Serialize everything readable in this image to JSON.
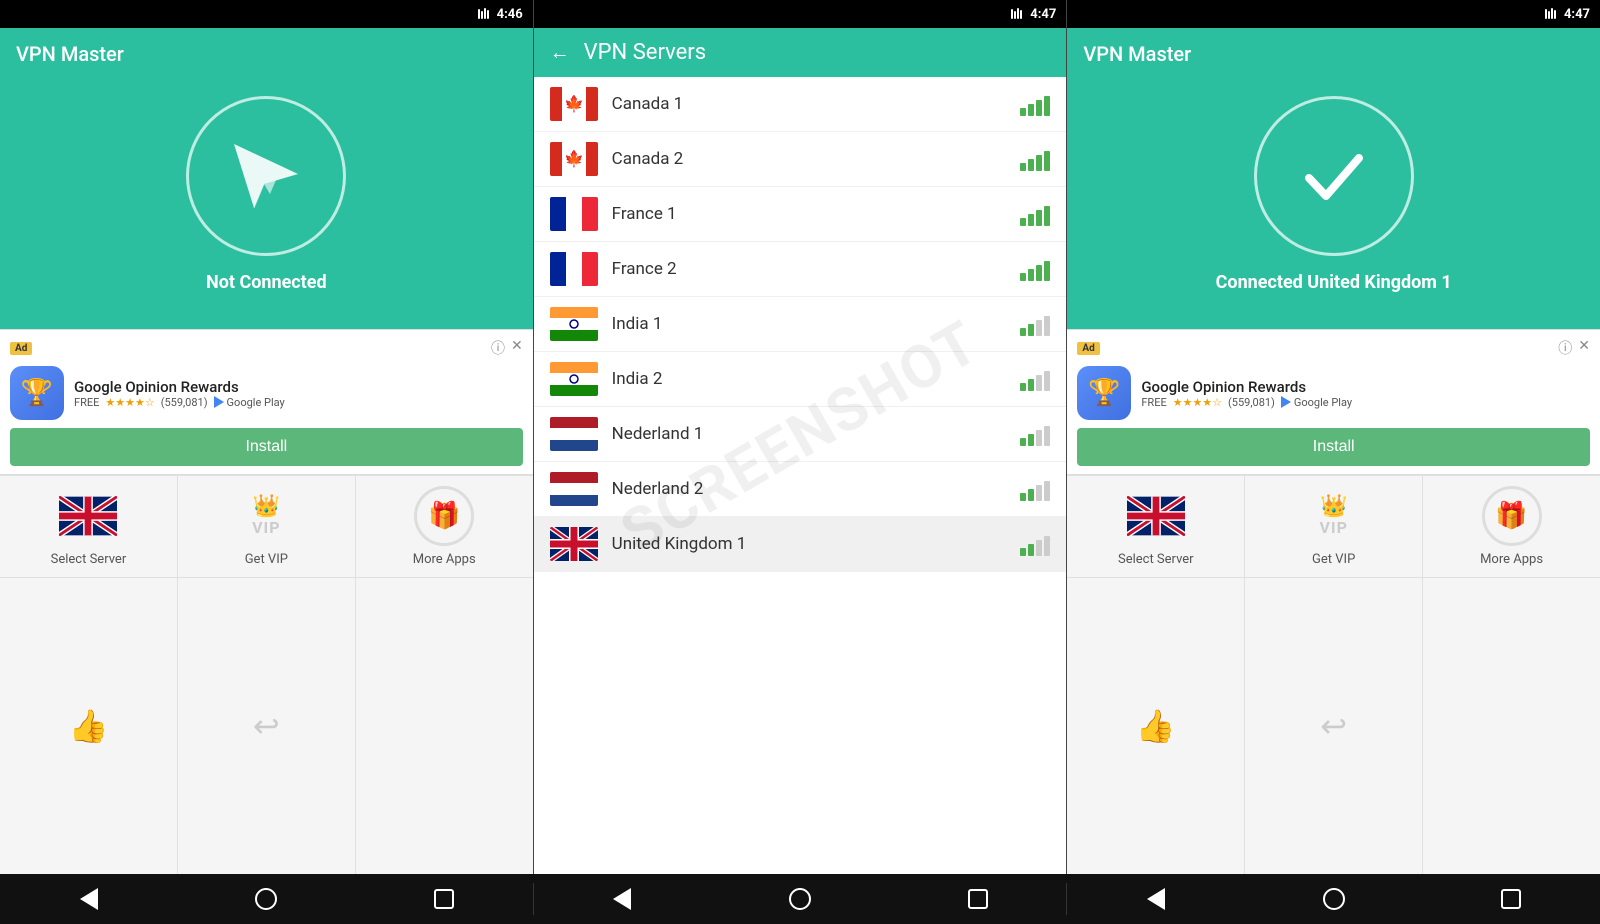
{
  "screens": {
    "left": {
      "title": "VPN Master",
      "time": "4:46",
      "status": "Not Connected",
      "circle_icon": "plane",
      "ad": {
        "app_name": "Google Opinion Rewards",
        "free_label": "FREE",
        "rating": "★★★★☆",
        "reviews": "(559,081)",
        "install_label": "Install",
        "ad_label": "Ad",
        "info_label": "ⓘ",
        "close_label": "✕",
        "google_play": "Google Play"
      },
      "nav_items": [
        {
          "label": "Select Server",
          "icon": "uk-flag"
        },
        {
          "label": "Get VIP",
          "icon": "vip"
        },
        {
          "label": "More Apps",
          "icon": "gift"
        }
      ],
      "bottom_icons": [
        "thumb",
        "share"
      ]
    },
    "middle": {
      "title": "VPN Servers",
      "time": "4:47",
      "back_label": "←",
      "watermark": "SCREENSHOT",
      "servers": [
        {
          "name": "Canada 1",
          "flag": "canada",
          "signal": 4
        },
        {
          "name": "Canada 2",
          "flag": "canada",
          "signal": 4
        },
        {
          "name": "France 1",
          "flag": "france",
          "signal": 4
        },
        {
          "name": "France 2",
          "flag": "france",
          "signal": 4
        },
        {
          "name": "India 1",
          "flag": "india",
          "signal": 3
        },
        {
          "name": "India 2",
          "flag": "india",
          "signal": 3
        },
        {
          "name": "Nederland 1",
          "flag": "netherlands",
          "signal": 3
        },
        {
          "name": "Nederland 2",
          "flag": "netherlands",
          "signal": 3
        },
        {
          "name": "United Kingdom 1",
          "flag": "uk",
          "signal": 2,
          "selected": true
        }
      ]
    },
    "right": {
      "title": "VPN Master",
      "time": "4:47",
      "status": "Connected  United Kingdom 1",
      "circle_icon": "check",
      "ad": {
        "app_name": "Google Opinion Rewards",
        "free_label": "FREE",
        "rating": "★★★★☆",
        "reviews": "(559,081)",
        "install_label": "Install",
        "ad_label": "Ad",
        "info_label": "ⓘ",
        "close_label": "✕",
        "google_play": "Google Play"
      },
      "nav_items": [
        {
          "label": "Select Server",
          "icon": "uk-flag"
        },
        {
          "label": "Get VIP",
          "icon": "vip"
        },
        {
          "label": "More Apps",
          "icon": "gift"
        }
      ],
      "bottom_icons": [
        "thumb",
        "share"
      ]
    }
  },
  "android_nav": {
    "back": "◁",
    "home": "○",
    "recent": "□"
  },
  "colors": {
    "teal": "#2BBFA0",
    "green": "#4CAF50",
    "install_green": "#5cb87a"
  }
}
